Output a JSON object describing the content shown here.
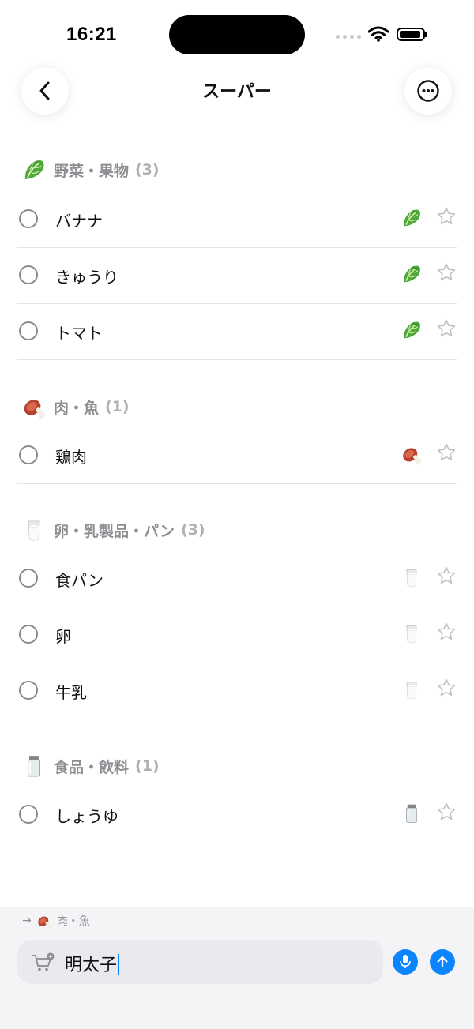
{
  "status_bar": {
    "time": "16:21"
  },
  "nav": {
    "title": "スーパー",
    "back_icon": "chevron-left-icon",
    "more_icon": "ellipsis-circle-icon"
  },
  "sections": [
    {
      "icon": "lettuce-icon",
      "label": "野菜・果物",
      "count": "(3)",
      "items": [
        {
          "label": "バナナ",
          "category_icon": "lettuce-icon",
          "starred": false
        },
        {
          "label": "きゅうり",
          "category_icon": "lettuce-icon",
          "starred": false
        },
        {
          "label": "トマト",
          "category_icon": "lettuce-icon",
          "starred": false
        }
      ]
    },
    {
      "icon": "meat-icon",
      "label": "肉・魚",
      "count": "(1)",
      "items": [
        {
          "label": "鶏肉",
          "category_icon": "meat-icon",
          "starred": false
        }
      ]
    },
    {
      "icon": "milk-glass-icon",
      "label": "卵・乳製品・パン",
      "count": "(3)",
      "items": [
        {
          "label": "食パン",
          "category_icon": "milk-glass-icon",
          "starred": false
        },
        {
          "label": "卵",
          "category_icon": "milk-glass-icon",
          "starred": false
        },
        {
          "label": "牛乳",
          "category_icon": "milk-glass-icon",
          "starred": false
        }
      ]
    },
    {
      "icon": "jar-icon",
      "label": "食品・飲料",
      "count": "(1)",
      "items": [
        {
          "label": "しょうゆ",
          "category_icon": "jar-icon",
          "starred": false
        }
      ]
    }
  ],
  "composer": {
    "hint_category": "肉・魚",
    "hint_icon": "meat-icon",
    "input_value": "明太子",
    "cart_icon": "cart-add-icon",
    "mic_icon": "microphone-icon",
    "send_icon": "arrow-up-icon"
  },
  "colors": {
    "accent": "#0a84ff",
    "section_label": "#8e8e93",
    "divider": "#e3e3e6"
  }
}
